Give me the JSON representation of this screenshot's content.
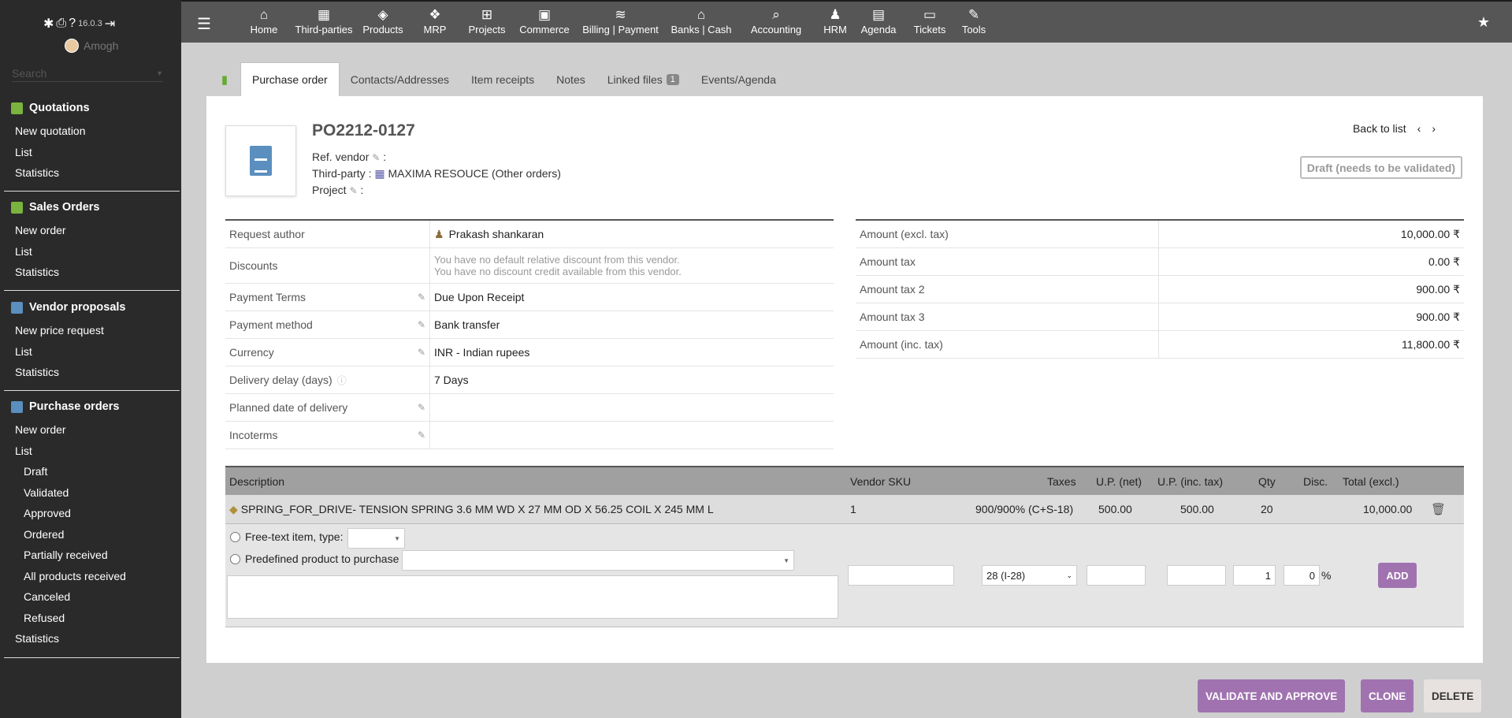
{
  "sidebar": {
    "version": "16.0.3",
    "user": "Amogh",
    "search_placeholder": "Search",
    "sections": [
      {
        "title": "Quotations",
        "items": [
          "New quotation",
          "List",
          "Statistics"
        ]
      },
      {
        "title": "Sales Orders",
        "items": [
          "New order",
          "List",
          "Statistics"
        ]
      },
      {
        "title": "Vendor proposals",
        "items": [
          "New price request",
          "List",
          "Statistics"
        ]
      },
      {
        "title": "Purchase orders",
        "items": [
          "New order",
          "List"
        ],
        "subitems": [
          "Draft",
          "Validated",
          "Approved",
          "Ordered",
          "Partially received",
          "All products received",
          "Canceled",
          "Refused"
        ],
        "after": "Statistics"
      }
    ]
  },
  "topnav": [
    "Home",
    "Third-parties",
    "Products",
    "MRP",
    "Projects",
    "Commerce",
    "Billing | Payment",
    "Banks | Cash",
    "Accounting",
    "HRM",
    "Agenda",
    "Tickets",
    "Tools"
  ],
  "tabs": {
    "purchase_order": "Purchase order",
    "contacts": "Contacts/Addresses",
    "receipts": "Item receipts",
    "notes": "Notes",
    "files": "Linked files",
    "files_count": "1",
    "events": "Events/Agenda"
  },
  "header": {
    "ref": "PO2212-0127",
    "ref_vendor_label": "Ref. vendor",
    "third_party_label": "Third-party :",
    "third_party_value": "MAXIMA RESOUCE",
    "other_orders": "(Other orders)",
    "project_label": "Project",
    "back_to_list": "Back to list",
    "status": "Draft (needs to be validated)"
  },
  "fields": {
    "request_author_label": "Request author",
    "request_author_value": "Prakash shankaran",
    "discounts_label": "Discounts",
    "discount_line1": "You have no default relative discount from this vendor.",
    "discount_line2": "You have no discount credit available from this vendor.",
    "payment_terms_label": "Payment Terms",
    "payment_terms_value": "Due Upon Receipt",
    "payment_method_label": "Payment method",
    "payment_method_value": "Bank transfer",
    "currency_label": "Currency",
    "currency_value": "INR - Indian rupees",
    "delivery_delay_label": "Delivery delay (days)",
    "delivery_delay_value": "7 Days",
    "planned_date_label": "Planned date of delivery",
    "incoterms_label": "Incoterms"
  },
  "amounts": {
    "excl_label": "Amount (excl. tax)",
    "excl_value": "10,000.00 ₹",
    "tax_label": "Amount tax",
    "tax_value": "0.00 ₹",
    "tax2_label": "Amount tax 2",
    "tax2_value": "900.00 ₹",
    "tax3_label": "Amount tax 3",
    "tax3_value": "900.00 ₹",
    "inc_label": "Amount (inc. tax)",
    "inc_value": "11,800.00 ₹"
  },
  "lines": {
    "headers": {
      "description": "Description",
      "vendor_sku": "Vendor SKU",
      "taxes": "Taxes",
      "up_net": "U.P. (net)",
      "up_inc": "U.P. (inc. tax)",
      "qty": "Qty",
      "disc": "Disc.",
      "total": "Total (excl.)"
    },
    "row": {
      "product_ref": "SPRING_FOR_DRIVE",
      "product_desc": " - TENSION SPRING 3.6 MM WD X 27 MM OD X 56.25 COIL X 245 MM L",
      "vendor_sku": "1",
      "taxes": "900/900% (C+S-18)",
      "up_net": "500.00",
      "up_inc": "500.00",
      "qty": "20",
      "total": "10,000.00"
    },
    "add": {
      "free_text_label": "Free-text item, type:",
      "predefined_label": "Predefined product to purchase",
      "tax_select": "28 (I-28)",
      "qty_value": "1",
      "disc_value": "0",
      "percent": "%",
      "add_button": "ADD"
    }
  },
  "actions": {
    "validate": "VALIDATE AND APPROVE",
    "clone": "CLONE",
    "delete": "DELETE"
  }
}
